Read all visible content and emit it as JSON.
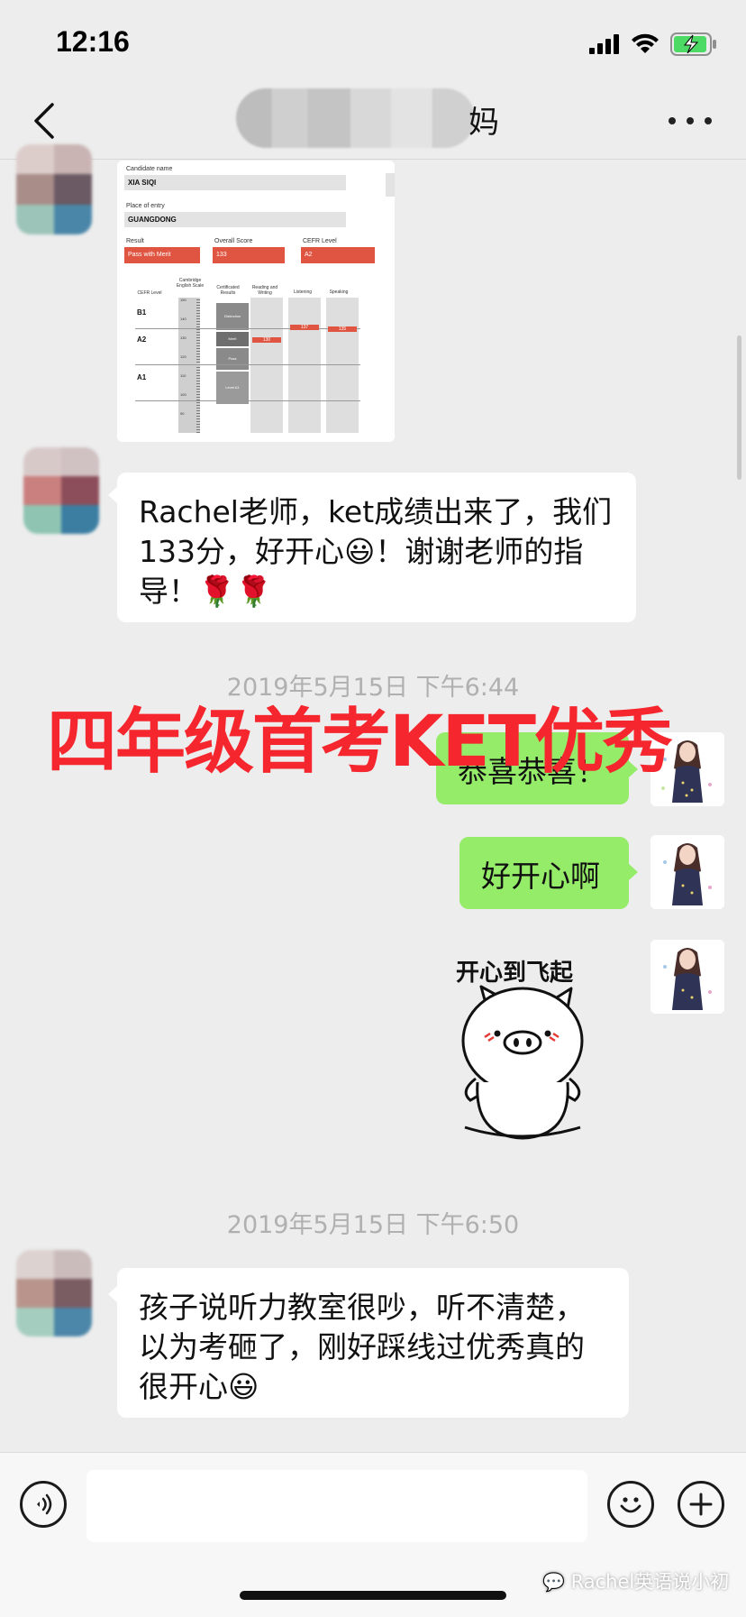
{
  "status_bar": {
    "time": "12:16"
  },
  "header": {
    "title_suffix": "妈"
  },
  "certificate": {
    "candidate_name_label": "Candidate name",
    "candidate_name": "XIA SIQI",
    "place_label": "Place of entry",
    "place": "GUANGDONG",
    "result_label": "Result",
    "result": "Pass with Merit",
    "overall_label": "Overall Score",
    "overall": "133",
    "cefr_label": "CEFR Level",
    "cefr": "A2",
    "table": {
      "col_cefr": "CEFR Level",
      "col_scale": "Cambridge English Scale",
      "col_cert": "Certificated Results",
      "col_rw": "Reading and Writing",
      "col_listening": "Listening",
      "col_speaking": "Speaking",
      "levels": [
        "B1",
        "A2",
        "A1"
      ],
      "scale_ticks": [
        "150",
        "140",
        "130",
        "120",
        "110",
        "100",
        "90"
      ],
      "grades": [
        "Distinction",
        "Merit",
        "Pass",
        "Level A1"
      ],
      "scores": {
        "reading_writing": "130",
        "listening": "137",
        "speaking": "135"
      }
    }
  },
  "messages": {
    "msg1": "Rachel老师，ket成绩出来了，我们133分，好开心😃！谢谢老师的指导！🌹🌹",
    "time1": "2019年5月15日 下午6:44",
    "reply1": "恭喜恭喜！",
    "reply2": "好开心啊",
    "sticker_caption": "开心到飞起",
    "time2": "2019年5月15日 下午6:50",
    "msg2": "孩子说听力教室很吵，听不清楚，以为考砸了，刚好踩线过优秀真的很开心😃"
  },
  "overlay_caption": "四年级首考KET优秀",
  "watermark": "Rachel英语说小初",
  "colors": {
    "accent_red": "#f5262d",
    "bubble_green": "#95ec69",
    "background": "#ededed"
  }
}
